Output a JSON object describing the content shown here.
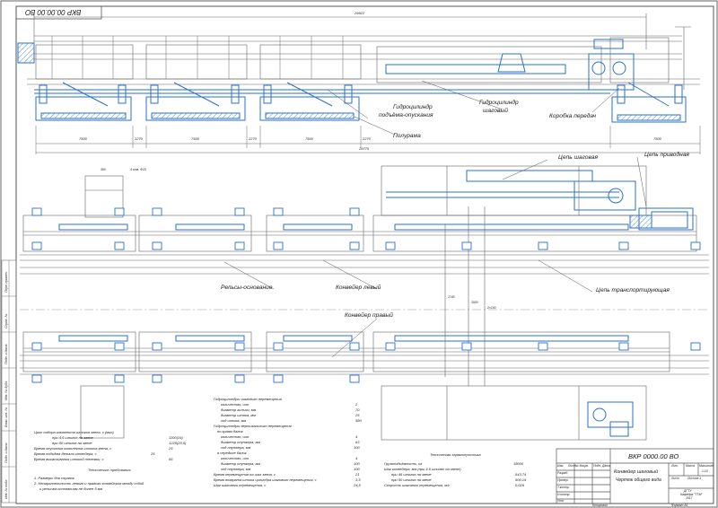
{
  "drawing_code": "ВКР 0000.00 ВО",
  "drawing_code_rotated": "ВКР 00.00.00 ВО",
  "top_view": {
    "overall_dim": "29922",
    "labels": {
      "hydro_lift": [
        "Гидроцилиндр",
        "подъёма-опускания"
      ],
      "hydro_step": [
        "Гидроцилиндр",
        "шаговый"
      ],
      "gearbox": "Коробка передач",
      "half_frame": "Полурама"
    },
    "dims_bottom": [
      "7500",
      "2270",
      "7500",
      "2270",
      "7500",
      "2270",
      "7500"
    ],
    "dims_total": "29775"
  },
  "plan_view": {
    "labels": {
      "step_chain": "Цепь шаговая",
      "drive_chain": "Цепь приводная",
      "rails": "Рельсы-основание",
      "conveyor_left": "Конвейер левый",
      "conveyor_right": "Конвейер правый",
      "transport_chain": "Цепь транспортирующая"
    },
    "detail_dims": [
      "360",
      "4 отв. Ф18"
    ],
    "vertical_dims": [
      "1740",
      "3930",
      "2×100"
    ]
  },
  "notes_left": [
    {
      "k": "Цикл набора комплекта штоков звена, с (мин)",
      "v": ""
    },
    {
      "k": "при 4,6 шпилях на звене",
      "v": "1100(19)"
    },
    {
      "k": "при 50 шпилях на звене",
      "v": "1225(20,5)"
    },
    {
      "k": "Время опускания комплекта штоков звена, с",
      "v": "25"
    },
    {
      "k": "Время подъёма детали конвейера, с",
      "v": "25"
    },
    {
      "k": "Время выкатывания штокой тележки, с",
      "v": "65"
    }
  ],
  "notes_tech_title": "Технические требования",
  "notes_tech": [
    "1. Размеры для справок",
    "2. Непараллельность левого и правого конвейеров между собой",
    "и рельсам-основаниям не более 5 мм"
  ],
  "hydro_specs": [
    {
      "k": "Гидроцилиндры шагового перемещения",
      "v": ""
    },
    {
      "k": "количество, шт.",
      "v": "2"
    },
    {
      "k": "диаметр гильзы, мм",
      "v": "70"
    },
    {
      "k": "диаметр штока, мм",
      "v": "25"
    },
    {
      "k": "ход штока, мм",
      "v": "580"
    },
    {
      "k": "Гидроцилиндры вертикального перемещения",
      "v": ""
    },
    {
      "k": "по краям балок",
      "v": ""
    },
    {
      "k": "количество, шт.",
      "v": "4"
    },
    {
      "k": "диаметр плунжера, мм",
      "v": "63"
    },
    {
      "k": "ход плунжера, мм",
      "v": "100"
    },
    {
      "k": "в середине балок",
      "v": ""
    },
    {
      "k": "количество, шт.",
      "v": "4"
    },
    {
      "k": "диаметр плунжера, мм",
      "v": "100"
    },
    {
      "k": "ход плунжера, мм",
      "v": "100"
    },
    {
      "k": "Время перемещения на шаг звена, с",
      "v": "21"
    },
    {
      "k": "Время возврата штока цилиндра шагового перемещения, с",
      "v": "3,5"
    },
    {
      "k": "Шаг шагового перемещения, с",
      "v": "24,5"
    }
  ],
  "char_title": "Техническая характеристика",
  "characteristics": [
    {
      "k": "Грузоподъёмность, кг",
      "v": "18000"
    },
    {
      "k": "Шаг конвейера, мм (при 4,6 шпилях на звене)",
      "v": ""
    },
    {
      "k": "при 46 шпилях на звене",
      "v": "543,74"
    },
    {
      "k": "при 50 шпилях на звене",
      "v": "500,19"
    },
    {
      "k": "Скорость шагового перемещения, м/с",
      "v": "0,026"
    }
  ],
  "title_block": {
    "code": "ВКР 0000.00 ВО",
    "name": [
      "Конвейер шаговый",
      "Чертеж общего вида"
    ],
    "mass_scale": "1:10",
    "lit": "Лит.",
    "mass": "Масса",
    "scale": "Масштаб",
    "sheet": "Лист",
    "sheets": "Листов 1",
    "org": [
      "ДГТУ",
      "Кафедра \"ТТМ\"",
      "2017"
    ],
    "roles": [
      "Изм.",
      "Лист",
      "№ докум.",
      "Подп.",
      "Дата",
      "Разраб.",
      "Провер.",
      "Т.контр.",
      "Н.контр.",
      "Утв."
    ],
    "copied": "Копировал",
    "format": "Формат А1"
  },
  "side_strip": [
    "Перв. примен.",
    "Справ. №",
    "Подп. и дата",
    "Инв. № дубл.",
    "Взам. инв. №",
    "Подп. и дата",
    "Инв. № подл."
  ],
  "colors": {
    "blue": "#2a6fd6",
    "line": "#555555",
    "light": "#7a9fd0"
  }
}
